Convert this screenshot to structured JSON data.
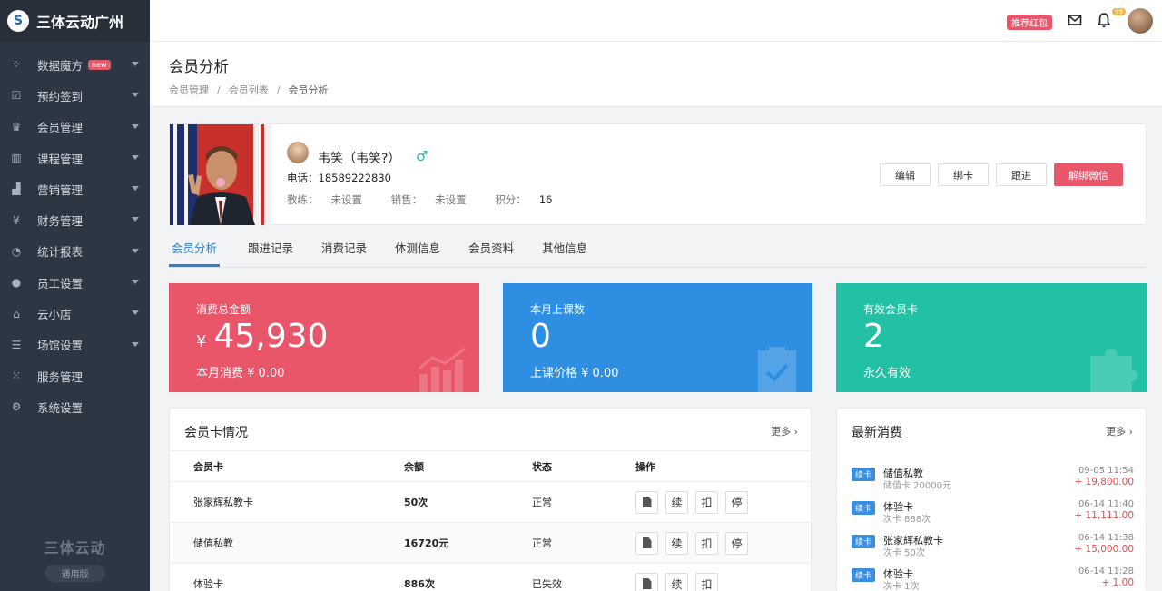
{
  "app": {
    "title": "三体云动广州",
    "logo_text": "S"
  },
  "sidebar": {
    "items": [
      {
        "label": "数据魔方",
        "badge": "new",
        "icon": "cube-grid-icon",
        "glyph": "⁘"
      },
      {
        "label": "预约签到",
        "icon": "checkbox-icon",
        "glyph": "☑"
      },
      {
        "label": "会员管理",
        "icon": "crown-icon",
        "glyph": "♛"
      },
      {
        "label": "课程管理",
        "icon": "books-icon",
        "glyph": "▥"
      },
      {
        "label": "营销管理",
        "icon": "bar-chart-icon",
        "glyph": "▟"
      },
      {
        "label": "财务管理",
        "icon": "money-icon",
        "glyph": "¥"
      },
      {
        "label": "统计报表",
        "icon": "pie-chart-icon",
        "glyph": "◔"
      },
      {
        "label": "员工设置",
        "icon": "user-icon",
        "glyph": "●"
      },
      {
        "label": "云小店",
        "icon": "store-icon",
        "glyph": "⌂"
      },
      {
        "label": "场馆设置",
        "icon": "sliders-icon",
        "glyph": "☰"
      },
      {
        "label": "服务管理",
        "icon": "apps-grid-icon",
        "glyph": "⁙"
      },
      {
        "label": "系统设置",
        "icon": "gear-icon",
        "glyph": "⚙"
      }
    ],
    "footer_logo": "三体云动",
    "footer_version": "通用版"
  },
  "topbar": {
    "red_packet": "推荐红包",
    "notification_count": "99"
  },
  "page": {
    "title": "会员分析",
    "breadcrumbs": [
      "会员管理",
      "会员列表",
      "会员分析"
    ]
  },
  "profile": {
    "name": "韦笑（韦笑?）",
    "gender": "♂",
    "phone_label": "电话：",
    "phone": "18589222830",
    "coach_label": "教练：",
    "coach": "未设置",
    "sales_label": "销售：",
    "sales": "未设置",
    "points_label": "积分：",
    "points": "16",
    "buttons": [
      "编辑",
      "绑卡",
      "跟进",
      "解绑微信"
    ]
  },
  "tabs": [
    "会员分析",
    "跟进记录",
    "消费记录",
    "体测信息",
    "会员资料",
    "其他信息"
  ],
  "stats": [
    {
      "title": "消费总金额",
      "currency": "¥",
      "value": "45,930",
      "sub": "本月消费 ¥ 0.00",
      "color": "#e9566a"
    },
    {
      "title": "本月上课数",
      "currency": "",
      "value": "0",
      "sub": "上课价格 ¥ 0.00",
      "color": "#2e8fe2"
    },
    {
      "title": "有效会员卡",
      "currency": "",
      "value": "2",
      "sub": "永久有效",
      "color": "#22c0a5"
    }
  ],
  "cards": {
    "title": "会员卡情况",
    "more": "更多",
    "headers": [
      "会员卡",
      "余额",
      "状态",
      "操作"
    ],
    "ops": [
      "续",
      "扣",
      "停"
    ],
    "rows": [
      {
        "name": "张家辉私教卡",
        "balance": "50次",
        "status": "正常"
      },
      {
        "name": "储值私教",
        "balance": "16720元",
        "status": "正常"
      },
      {
        "name": "体验卡",
        "balance": "886次",
        "status": "已失效"
      }
    ]
  },
  "recent": {
    "title": "最新消费",
    "more": "更多",
    "items": [
      {
        "tag": "续卡",
        "name": "储值私教",
        "sub": "储值卡 20000元",
        "time": "09-05 11:54",
        "amount": "+ 19,800.00"
      },
      {
        "tag": "续卡",
        "name": "体验卡",
        "sub": "次卡 888次",
        "time": "06-14 11:40",
        "amount": "+ 11,111.00"
      },
      {
        "tag": "续卡",
        "name": "张家辉私教卡",
        "sub": "次卡 50次",
        "time": "06-14 11:38",
        "amount": "+ 15,000.00"
      },
      {
        "tag": "续卡",
        "name": "体验卡",
        "sub": "次卡 1次",
        "time": "06-14 11:28",
        "amount": "+ 1.00"
      }
    ]
  }
}
